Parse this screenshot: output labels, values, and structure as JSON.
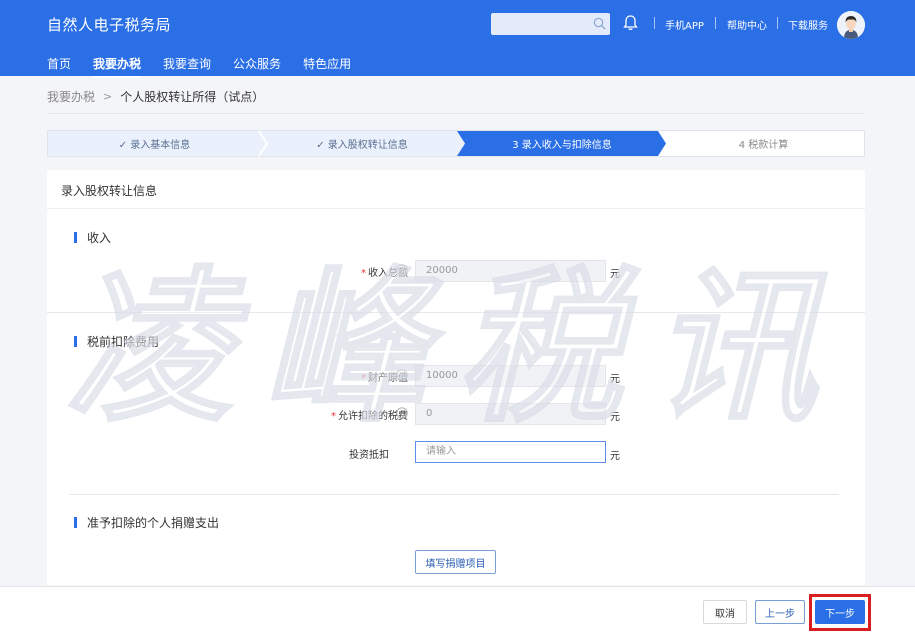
{
  "header": {
    "title": "自然人电子税务局",
    "search_placeholder": "",
    "links": [
      "手机APP",
      "帮助中心",
      "下载服务"
    ]
  },
  "nav": {
    "items": [
      {
        "label": "首页",
        "active": false
      },
      {
        "label": "我要办税",
        "active": true
      },
      {
        "label": "我要查询",
        "active": false
      },
      {
        "label": "公众服务",
        "active": false
      },
      {
        "label": "特色应用",
        "active": false
      }
    ]
  },
  "breadcrumb": {
    "parent": "我要办税",
    "separator": ">",
    "current": "个人股权转让所得（试点）"
  },
  "steps": [
    {
      "label": "✓ 录入基本信息",
      "state": "done"
    },
    {
      "label": "✓ 录入股权转让信息",
      "state": "done"
    },
    {
      "label": "3  录入收入与扣除信息",
      "state": "active"
    },
    {
      "label": "4  税款计算",
      "state": "todo"
    }
  ],
  "panel": {
    "title": "录入股权转让信息",
    "sections": {
      "income": {
        "title": "收入",
        "fields": {
          "total_income": {
            "label": "收入总额",
            "value": "20000",
            "unit": "元"
          }
        }
      },
      "deduction": {
        "title": "税前扣除费用",
        "fields": {
          "original_value": {
            "label": "财产原值",
            "value": "10000",
            "unit": "元"
          },
          "deductible_tax": {
            "label": "允许扣除的税费",
            "value": "0",
            "unit": "元"
          },
          "investment_offset": {
            "label": "投资抵扣",
            "placeholder": "请输入",
            "unit": "元"
          }
        }
      },
      "donation": {
        "title": "准予扣除的个人捐赠支出",
        "button": "填写捐赠项目"
      }
    }
  },
  "footer": {
    "cancel": "取消",
    "prev": "上一步",
    "next": "下一步"
  },
  "watermark": {
    "text": "凌峰税讯"
  },
  "colors": {
    "header_bg": "#2b6fe6",
    "active_step": "#2b6fe6",
    "highlight_frame": "#d81e1e",
    "required_mark": "#e33333"
  }
}
